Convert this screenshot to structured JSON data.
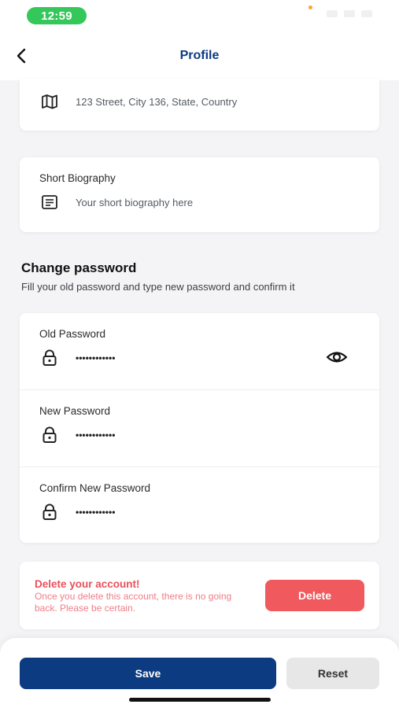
{
  "status_bar": {
    "time": "12:59"
  },
  "header": {
    "title": "Profile",
    "back_icon": "chevron-left-icon"
  },
  "address": {
    "icon": "map-icon",
    "value": "123 Street, City 136, State, Country"
  },
  "biography": {
    "label": "Short Biography",
    "icon": "document-icon",
    "placeholder": "Your short biography here"
  },
  "change_password": {
    "title": "Change password",
    "subtitle": "Fill your old password and type new password and confirm it",
    "fields": [
      {
        "label": "Old Password",
        "value": "••••••••••••",
        "icon": "lock-icon",
        "has_eye": true
      },
      {
        "label": "New Password",
        "value": "••••••••••••",
        "icon": "lock-icon",
        "has_eye": false
      },
      {
        "label": "Confirm New Password",
        "value": "••••••••••••",
        "icon": "lock-icon",
        "has_eye": false
      }
    ]
  },
  "delete_account": {
    "title": "Delete your account!",
    "description": "Once you delete this account, there is no going back. Please be certain.",
    "button_label": "Delete"
  },
  "footer": {
    "save_label": "Save",
    "reset_label": "Reset"
  },
  "colors": {
    "brand": "#0d3b82",
    "danger": "#f0595d",
    "status_green": "#34c759"
  }
}
